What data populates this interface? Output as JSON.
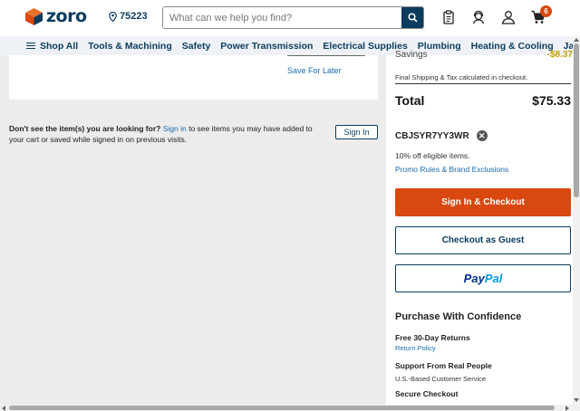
{
  "header": {
    "logo_text": "zoro",
    "zip": "75223",
    "search_placeholder": "What can we help you find?",
    "cart_count": "6"
  },
  "nav": {
    "shop_all": "Shop All",
    "items": [
      "Tools & Machining",
      "Safety",
      "Power Transmission",
      "Electrical Supplies",
      "Plumbing",
      "Heating & Cooling",
      "Janitorial & C"
    ]
  },
  "cart": {
    "save_for_later": "Save For Later",
    "missing_bold": "Don't see the item(s) you are looking for?",
    "missing_link": "Sign in",
    "missing_rest": "to see items you may have added to your cart or saved while signed in on previous visits.",
    "sign_in_button": "Sign In"
  },
  "summary": {
    "savings_label": "Savings",
    "savings_value": "-$8.37",
    "shipping_note": "Final Shipping & Tax calculated in checkout.",
    "total_label": "Total",
    "total_value": "$75.33",
    "promo_code": "CBJSYR7YY3WR",
    "promo_desc": "10% off eligible items.",
    "promo_rules": "Promo Rules & Brand Exclusions",
    "checkout_button": "Sign In & Checkout",
    "guest_button": "Checkout as Guest",
    "paypal_a": "Pay",
    "paypal_b": "Pal"
  },
  "confidence": {
    "title": "Purchase With Confidence",
    "returns": "Free 30-Day Returns",
    "returns_link": "Return Policy",
    "support": "Support From Real People",
    "support_sub": "U.S.-Based Customer Service",
    "secure": "Secure Checkout"
  },
  "colors": {
    "brand_navy": "#0b3c5d",
    "checkout_orange": "#d9480f",
    "link_blue": "#1a6aa8"
  }
}
